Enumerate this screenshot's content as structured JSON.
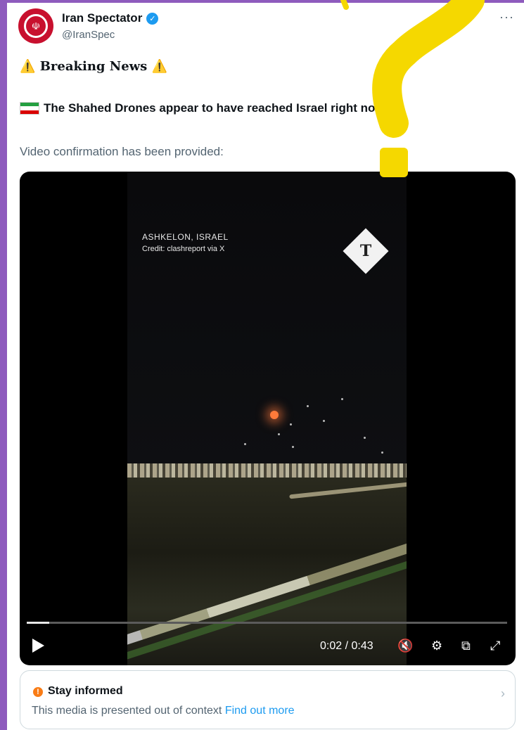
{
  "author": {
    "name": "Iran Spectator",
    "handle": "@IranSpec",
    "verified": true
  },
  "tweet": {
    "line1": "Breaking News",
    "line2": "The Shahed Drones appear to have reached Israel right now",
    "line3": "Video confirmation has been provided:"
  },
  "video": {
    "location": "ASHKELON, ISRAEL",
    "credit": "Credit: clashreport via X",
    "logo_letter": "T",
    "time": "0:02 / 0:43",
    "progress": 0.047
  },
  "notice": {
    "title": "Stay informed",
    "body": "This media is presented out of context",
    "link": "Find out more"
  },
  "colors": {
    "accent": "#1d9bf0",
    "warning": "#f97c16",
    "highlight": "#f5d800",
    "background": "#8e5bbd"
  },
  "icons": {
    "more": "more-icon",
    "warning": "warning-icon",
    "play": "play-icon",
    "mute": "mute-icon",
    "settings": "gear-icon",
    "pip": "picture-in-picture-icon",
    "fullscreen": "fullscreen-icon"
  }
}
